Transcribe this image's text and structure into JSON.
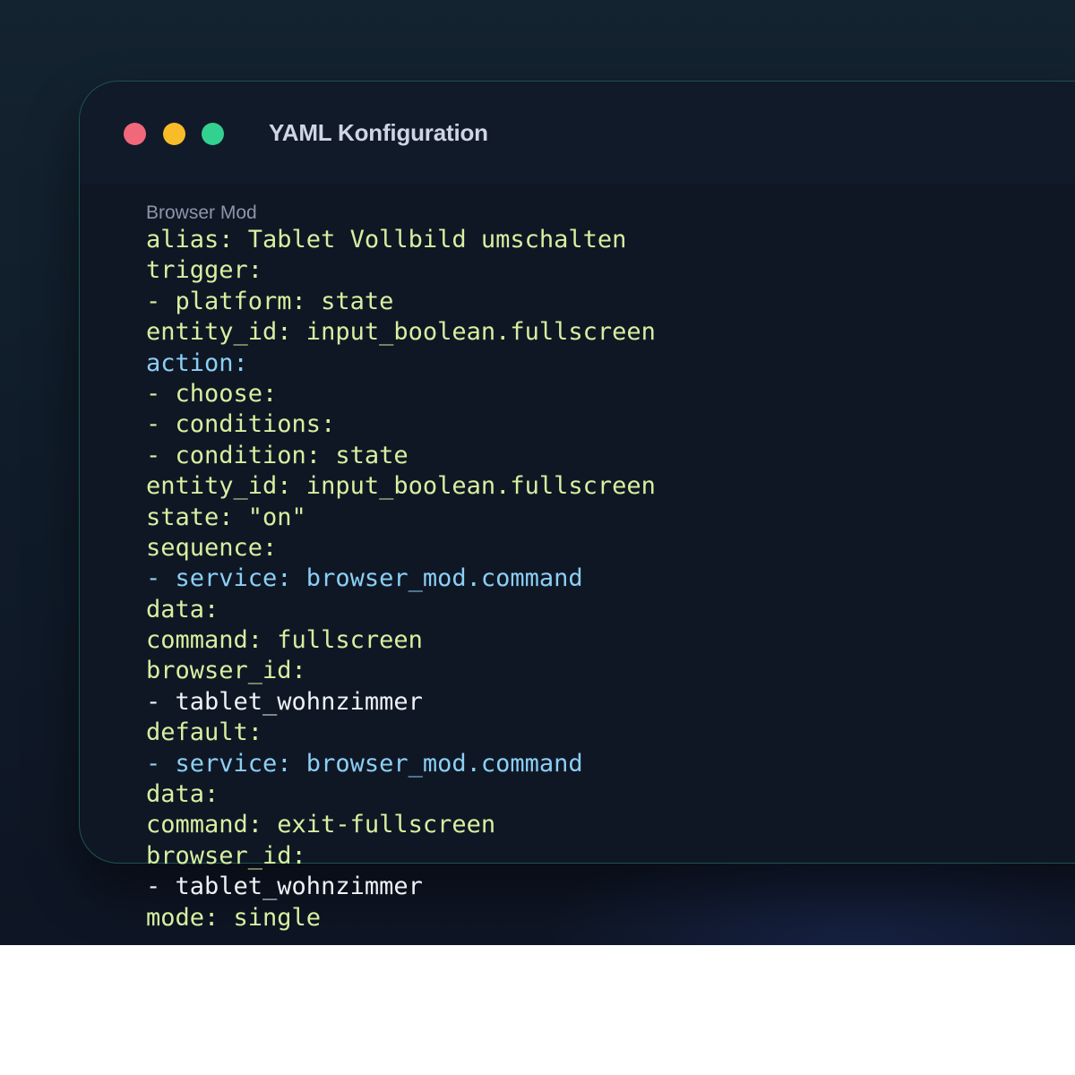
{
  "window": {
    "title": "YAML Konfiguration",
    "controls": {
      "close": "close-dot",
      "minimize": "minimize-dot",
      "maximize": "maximize-dot"
    }
  },
  "colors": {
    "close": "#f0687a",
    "minimize": "#f8bc28",
    "maximize": "#33d190",
    "key": "#d6f0a0",
    "keyword": "#8ccff5",
    "plain": "#eef2f6"
  },
  "code": {
    "label": "Browser Mod",
    "lines": [
      [
        {
          "t": "alias: Tablet Vollbild umschalten",
          "c": "key"
        }
      ],
      [
        {
          "t": "trigger:",
          "c": "key"
        }
      ],
      [
        {
          "t": "- platform: state",
          "c": "key"
        }
      ],
      [
        {
          "t": "entity_id: input_boolean.fullscreen",
          "c": "key"
        }
      ],
      [
        {
          "t": "action:",
          "c": "kw"
        }
      ],
      [
        {
          "t": "- choose:",
          "c": "key"
        }
      ],
      [
        {
          "t": "- conditions:",
          "c": "key"
        }
      ],
      [
        {
          "t": "- condition: state",
          "c": "key"
        }
      ],
      [
        {
          "t": "entity_id: input_boolean.fullscreen",
          "c": "key"
        }
      ],
      [
        {
          "t": "state: \"on\"",
          "c": "key"
        }
      ],
      [
        {
          "t": "sequence:",
          "c": "key"
        }
      ],
      [
        {
          "t": "- service: browser_mod.command",
          "c": "kw"
        }
      ],
      [
        {
          "t": "data:",
          "c": "key"
        }
      ],
      [
        {
          "t": "command: fullscreen",
          "c": "key"
        }
      ],
      [
        {
          "t": "browser_id:",
          "c": "key"
        }
      ],
      [
        {
          "t": "- tablet_wohnzimmer",
          "c": "plain"
        }
      ],
      [
        {
          "t": "default:",
          "c": "key"
        }
      ],
      [
        {
          "t": "- service: browser_mod.command",
          "c": "kw"
        }
      ],
      [
        {
          "t": "data:",
          "c": "key"
        }
      ],
      [
        {
          "t": "command: exit-fullscreen",
          "c": "key"
        }
      ],
      [
        {
          "t": "browser_id:",
          "c": "key"
        }
      ],
      [
        {
          "t": "- tablet_wohnzimmer",
          "c": "plain"
        }
      ],
      [
        {
          "t": "mode: single",
          "c": "key"
        }
      ]
    ]
  }
}
